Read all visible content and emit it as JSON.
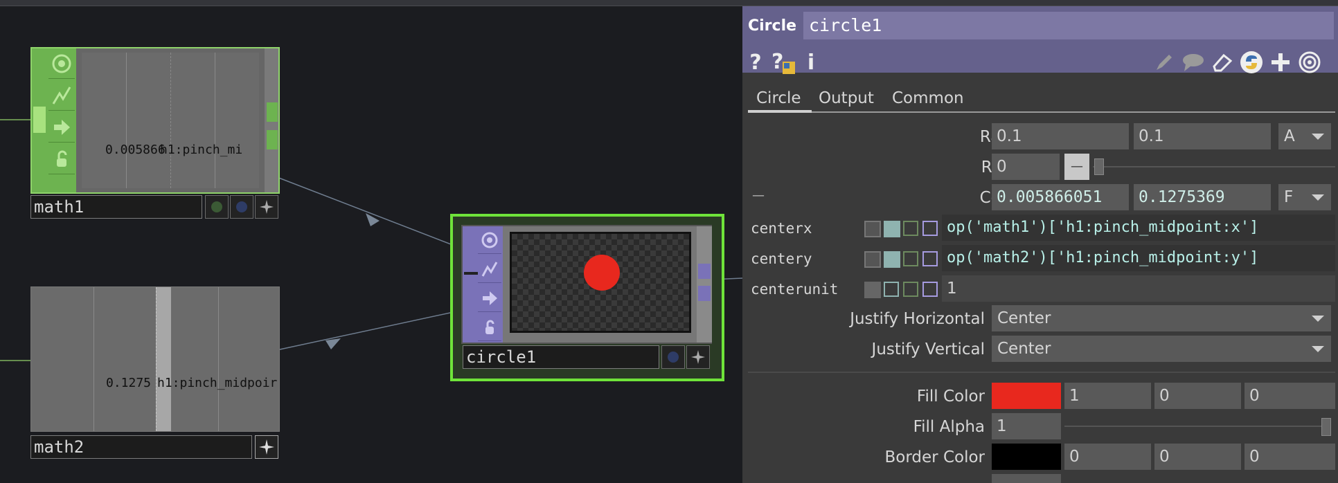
{
  "network": {
    "nodes": {
      "math1": {
        "name": "math1",
        "value": "0.005866",
        "channel": "h1:pinch_mi"
      },
      "math2": {
        "name": "math2",
        "value": "0.1275",
        "channel": "h1:pinch_midpoir"
      },
      "circle1": {
        "name": "circle1"
      }
    }
  },
  "panel": {
    "op_type": "Circle",
    "op_name": "circle1",
    "tabs": [
      "Circle",
      "Output",
      "Common"
    ],
    "active_tab": "Circle",
    "params": {
      "radius": {
        "label": "Radius",
        "x": "0.1",
        "y": "0.1",
        "mode": "A"
      },
      "rotate": {
        "label": "Rotate",
        "value": "0",
        "slider_btn": "—"
      },
      "center": {
        "label": "Center",
        "expand": "—",
        "x": "0.005866051",
        "y": "0.1275369",
        "mode": "F"
      },
      "centerx": {
        "label": "centerx",
        "expr": "op('math1')['h1:pinch_midpoint:x']"
      },
      "centery": {
        "label": "centery",
        "expr": "op('math2')['h1:pinch_midpoint:y']"
      },
      "centerunit": {
        "label": "centerunit",
        "value": "1"
      },
      "justify_h": {
        "label": "Justify Horizontal",
        "value": "Center"
      },
      "justify_v": {
        "label": "Justify Vertical",
        "value": "Center"
      },
      "fill_color": {
        "label": "Fill Color",
        "r": "1",
        "g": "0",
        "b": "0",
        "swatch": "#e8281e"
      },
      "fill_alpha": {
        "label": "Fill Alpha",
        "value": "1",
        "level": 1.0
      },
      "border_color": {
        "label": "Border Color",
        "r": "0",
        "g": "0",
        "b": "0",
        "swatch": "#000000"
      }
    }
  },
  "colors": {
    "accent_green": "#6db350",
    "selected_outline": "#6fe33a",
    "header_purple": "#65618c",
    "node_purple": "#7a72b8"
  },
  "icons": [
    "viewer-icon",
    "bypass-icon",
    "lock-icon",
    "cook-icon",
    "help-icon",
    "python-help-icon",
    "info-icon",
    "edit-icon",
    "comment-icon",
    "eraser-icon",
    "python-icon",
    "add-icon",
    "target-icon"
  ]
}
